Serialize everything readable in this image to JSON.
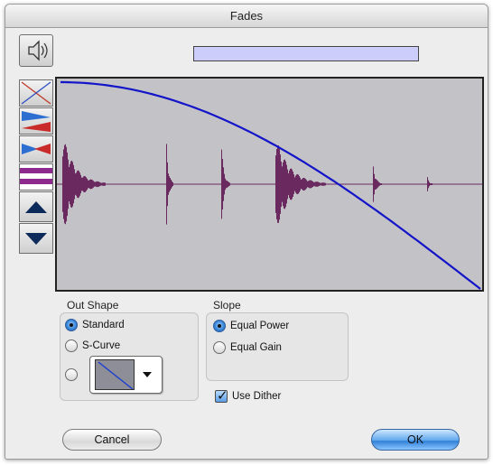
{
  "window": {
    "title": "Fades"
  },
  "progress": {
    "value": 1.0,
    "fill_color": "#cdcdfb"
  },
  "tools": [
    {
      "name": "speaker",
      "icon": "speaker-icon"
    },
    {
      "name": "crossfade-x",
      "icon": "cross-x-icon"
    },
    {
      "name": "blue-red-waves",
      "icon": "split-waveform-icon"
    },
    {
      "name": "red-blue-waves",
      "icon": "merged-waveform-icon"
    },
    {
      "name": "purple-stripe",
      "icon": "purple-stripe-icon",
      "selected": true
    },
    {
      "name": "zoom-up",
      "icon": "triangle-up-icon"
    },
    {
      "name": "zoom-down",
      "icon": "triangle-down-icon"
    }
  ],
  "display": {
    "curve_color": "#1414c8",
    "waveform_color": "#6a2a60",
    "background": "#c3c3c7"
  },
  "out_shape": {
    "label": "Out Shape",
    "options": [
      {
        "label": "Standard",
        "selected": true
      },
      {
        "label": "S-Curve",
        "selected": false
      },
      {
        "label": "",
        "selected": false
      }
    ]
  },
  "slope": {
    "label": "Slope",
    "options": [
      {
        "label": "Equal Power",
        "selected": true
      },
      {
        "label": "Equal Gain",
        "selected": false
      }
    ]
  },
  "dither": {
    "label": "Use Dither",
    "checked": true
  },
  "buttons": {
    "cancel": "Cancel",
    "ok": "OK"
  }
}
